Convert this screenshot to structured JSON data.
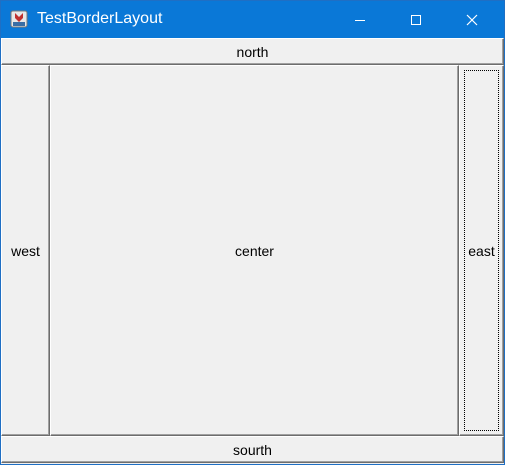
{
  "window": {
    "title": "TestBorderLayout",
    "titlebar_color": "#0a78d7",
    "icon": "java-app-icon",
    "controls": [
      "minimize-icon",
      "maximize-icon",
      "close-icon"
    ]
  },
  "layout": {
    "north": "north",
    "west": "west",
    "center": "center",
    "east": "east",
    "south": "sourth",
    "focused": "east"
  }
}
